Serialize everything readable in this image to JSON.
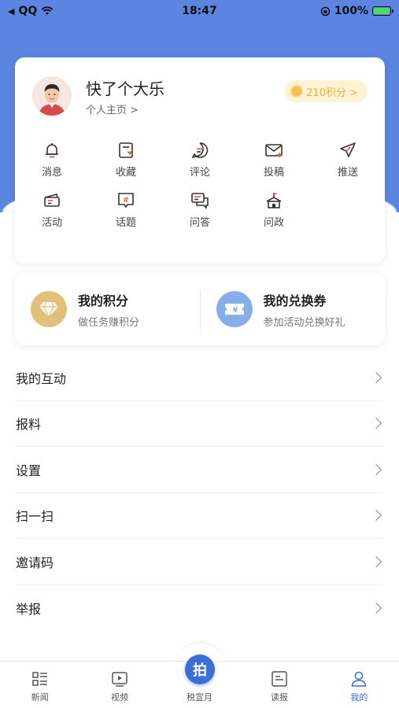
{
  "status_bar": {
    "carrier": "QQ",
    "time": "18:47",
    "battery": "100%"
  },
  "profile": {
    "name": "快了个大乐",
    "home_link": "个人主页 >",
    "points_label": "210积分 >"
  },
  "grid": [
    {
      "label": "消息",
      "icon": "bell-icon"
    },
    {
      "label": "收藏",
      "icon": "favorite-icon"
    },
    {
      "label": "评论",
      "icon": "comment-icon"
    },
    {
      "label": "投稿",
      "icon": "mail-icon"
    },
    {
      "label": "推送",
      "icon": "send-icon"
    },
    {
      "label": "活动",
      "icon": "activity-icon"
    },
    {
      "label": "话题",
      "icon": "topic-icon"
    },
    {
      "label": "问答",
      "icon": "qa-icon"
    },
    {
      "label": "问政",
      "icon": "government-icon"
    }
  ],
  "rewards": {
    "points": {
      "title": "我的积分",
      "subtitle": "做任务赚积分",
      "color": "#e2c07a"
    },
    "coupons": {
      "title": "我的兑换券",
      "subtitle": "参加活动兑换好礼",
      "color": "#86aee8"
    }
  },
  "menu": [
    {
      "label": "我的互动"
    },
    {
      "label": "报料"
    },
    {
      "label": "设置"
    },
    {
      "label": "扫一扫"
    },
    {
      "label": "邀请码"
    },
    {
      "label": "举报"
    }
  ],
  "tabbar": {
    "tabs": [
      {
        "label": "新闻",
        "icon": "news-icon"
      },
      {
        "label": "视频",
        "icon": "video-icon"
      },
      {
        "label": "税宣月",
        "icon": "camera-icon"
      },
      {
        "label": "读报",
        "icon": "newspaper-icon"
      },
      {
        "label": "我的",
        "icon": "user-icon"
      }
    ],
    "center_button": "拍",
    "active_color": "#3a6fd8"
  },
  "colors": {
    "header_bg": "#5b85e0"
  }
}
